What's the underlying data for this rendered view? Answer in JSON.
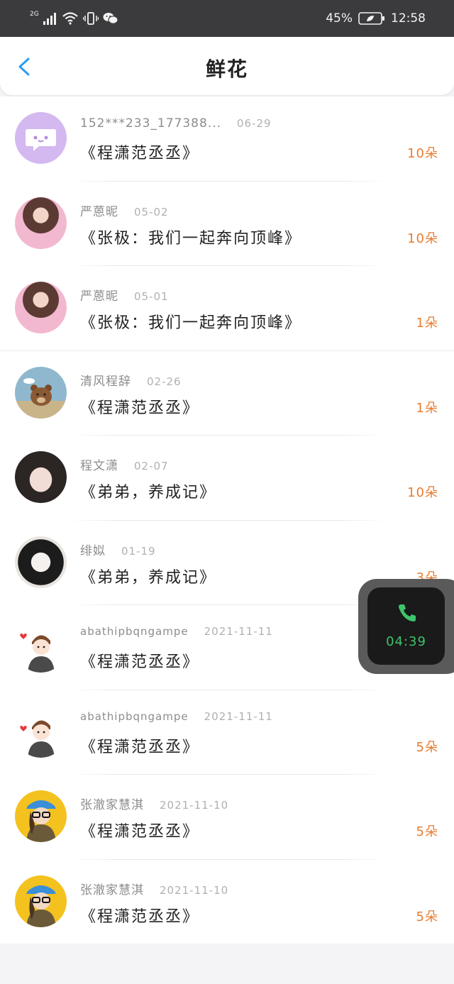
{
  "status_bar": {
    "network": "2G",
    "battery_percent": "45%",
    "time": "12:58"
  },
  "header": {
    "title": "鲜花"
  },
  "items": [
    {
      "name": "152***233_177388...",
      "date": "06-29",
      "book": "《程潇范丞丞》",
      "count": "10朵",
      "avatar": "chat-bubble-avatar"
    },
    {
      "name": "严蒽昵",
      "date": "05-02",
      "book": "《张极：我们一起奔向顶峰》",
      "count": "10朵",
      "avatar": "girl-avatar"
    },
    {
      "name": "严蒽昵",
      "date": "05-01",
      "book": "《张极：我们一起奔向顶峰》",
      "count": "1朵",
      "avatar": "girl-avatar"
    },
    {
      "name": "清风程辞",
      "date": "02-26",
      "book": "《程潇范丞丞》",
      "count": "1朵",
      "avatar": "bear-avatar"
    },
    {
      "name": "程文潇",
      "date": "02-07",
      "book": "《弟弟，养成记》",
      "count": "10朵",
      "avatar": "dark-hair-girl-avatar"
    },
    {
      "name": "绯姒",
      "date": "01-19",
      "book": "《弟弟，养成记》",
      "count": "3朵",
      "avatar": "sketch-girl-avatar"
    },
    {
      "name": "abathipbqngampe",
      "date": "2021-11-11",
      "book": "《程潇范丞丞》",
      "count": "",
      "avatar": "cartoon-boy-avatar"
    },
    {
      "name": "abathipbqngampe",
      "date": "2021-11-11",
      "book": "《程潇范丞丞》",
      "count": "5朵",
      "avatar": "cartoon-boy-avatar"
    },
    {
      "name": "张澈家慧淇",
      "date": "2021-11-10",
      "book": "《程潇范丞丞》",
      "count": "5朵",
      "avatar": "cap-girl-avatar"
    },
    {
      "name": "张澈家慧淇",
      "date": "2021-11-10",
      "book": "《程潇范丞丞》",
      "count": "5朵",
      "avatar": "cap-girl-avatar"
    }
  ],
  "floating_call": {
    "duration": "04:39"
  },
  "colors": {
    "accent_blue": "#2a9df4",
    "count_orange": "#e87b2f",
    "call_green": "#3ec46a"
  }
}
